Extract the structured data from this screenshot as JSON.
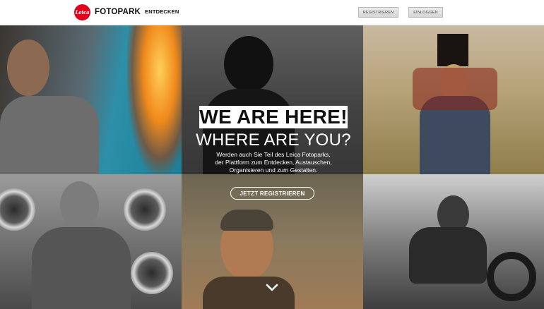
{
  "header": {
    "logo_text": "Leica",
    "brand": "FOTOPARK",
    "nav_discover": "ENTDECKEN",
    "register_label": "REGISTRIEREN",
    "login_label": "EINLOGGEN"
  },
  "hero": {
    "headline_1": "WE ARE HERE!",
    "headline_2": "WHERE ARE YOU?",
    "subtext_line1": "Werden auch Sie Teil des Leica Fotoparks,",
    "subtext_line2": "der Plattform zum Entdecken, Austauschen,",
    "subtext_line3": "Organisieren und zum Gestalten.",
    "cta_label": "JETZT REGISTRIEREN"
  },
  "icons": {
    "scroll_down": "chevron-down-icon"
  },
  "colors": {
    "brand_red": "#e2001a"
  }
}
